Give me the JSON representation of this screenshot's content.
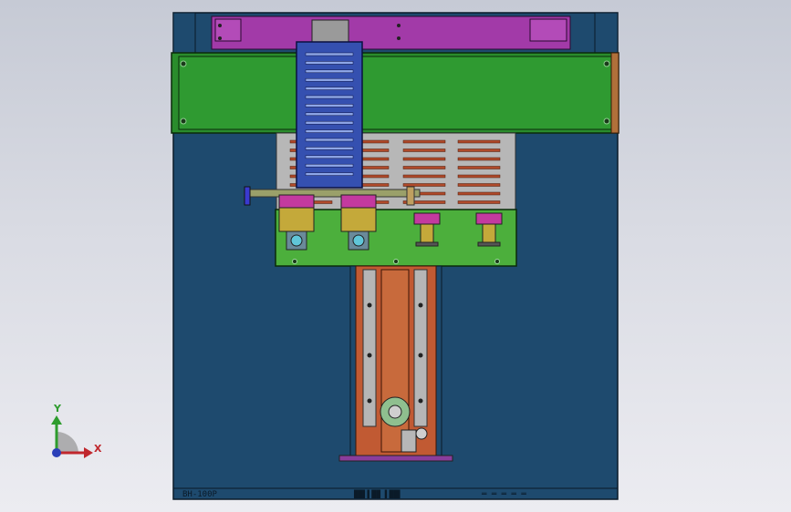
{
  "viewport": {
    "background": "#d9dbe3"
  },
  "model": {
    "colors": {
      "frame": "#1e4a6e",
      "frame_outline": "#0a1a28",
      "top_rail": "#a23aa8",
      "crossbeam": "#2a8c2c",
      "mesh_panel": "#3550b0",
      "grille_plate": "#b7b7b7",
      "slot_red": "#b04a2a",
      "carriage": "#4caf3c",
      "motor_yellow": "#c4a93a",
      "clamp_magenta": "#c33a9f",
      "linear_track": "#c15a33",
      "base_purple": "#8a3d9c"
    },
    "title_block": {
      "part_number": "BH-100P",
      "center_label": "██▌▌██ ▌██▌",
      "right_marks": "═ ═ ═ ═ ═"
    }
  },
  "triad": {
    "x_label": "X",
    "y_label": "Y",
    "x_color": "#c0272d",
    "y_color": "#2e9c2e",
    "z_color": "#2b3fb8"
  }
}
